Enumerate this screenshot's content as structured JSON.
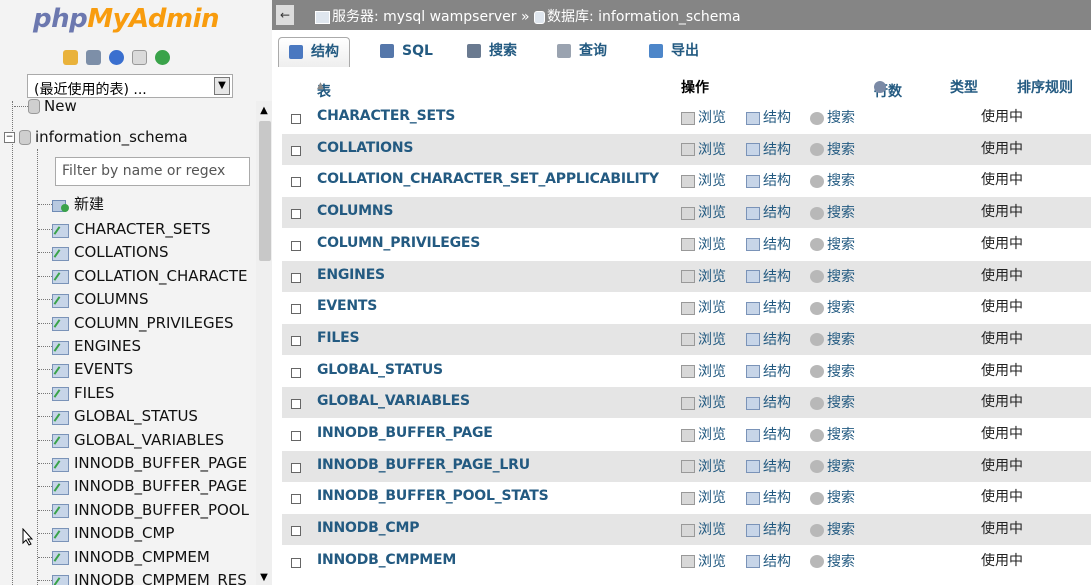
{
  "nav": {
    "logo_php": "php",
    "logo_myadmin": "MyAdmin",
    "recent_select": "(最近使用的表) ...",
    "filter_placeholder": "Filter by name or regex",
    "tree": {
      "new_db": "New",
      "db_name": "information_schema",
      "new_table": "新建",
      "tables": [
        "CHARACTER_SETS",
        "COLLATIONS",
        "COLLATION_CHARACTE",
        "COLUMNS",
        "COLUMN_PRIVILEGES",
        "ENGINES",
        "EVENTS",
        "FILES",
        "GLOBAL_STATUS",
        "GLOBAL_VARIABLES",
        "INNODB_BUFFER_PAGE",
        "INNODB_BUFFER_PAGE",
        "INNODB_BUFFER_POOL",
        "INNODB_CMP",
        "INNODB_CMPMEM",
        "INNODB_CMPMEM_RES"
      ]
    }
  },
  "breadcrumb": {
    "server": "服务器: mysql wampserver",
    "sep": "»",
    "database": "数据库: information_schema"
  },
  "tabs": [
    {
      "label": "结构",
      "icon": "structure-icon",
      "active": true
    },
    {
      "label": "SQL",
      "icon": "sql-icon",
      "active": false
    },
    {
      "label": "搜索",
      "icon": "search-icon",
      "active": false
    },
    {
      "label": "查询",
      "icon": "query-icon",
      "active": false
    },
    {
      "label": "导出",
      "icon": "export-icon",
      "active": false
    }
  ],
  "table": {
    "headers": {
      "table": "表",
      "sort_glyph": "▲",
      "actions": "操作",
      "rows": "行数",
      "type": "类型",
      "collation": "排序规则"
    },
    "actions": {
      "browse": "浏览",
      "structure": "结构",
      "search": "搜索"
    },
    "status_text": "使用中",
    "rows": [
      "CHARACTER_SETS",
      "COLLATIONS",
      "COLLATION_CHARACTER_SET_APPLICABILITY",
      "COLUMNS",
      "COLUMN_PRIVILEGES",
      "ENGINES",
      "EVENTS",
      "FILES",
      "GLOBAL_STATUS",
      "GLOBAL_VARIABLES",
      "INNODB_BUFFER_PAGE",
      "INNODB_BUFFER_PAGE_LRU",
      "INNODB_BUFFER_POOL_STATS",
      "INNODB_CMP",
      "INNODB_CMPMEM"
    ]
  },
  "colors": {
    "link": "#235a81",
    "topbar": "#858585",
    "row_alt": "#e5e5e5",
    "nav_bg": "#f3f3f3"
  }
}
